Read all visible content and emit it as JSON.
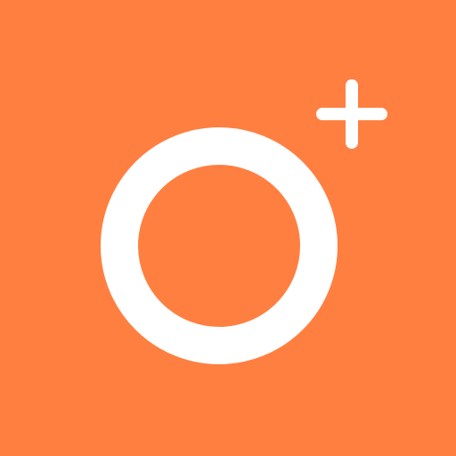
{
  "icon": {
    "name": "ring-plus-icon",
    "colors": {
      "background": "#FF7F41",
      "foreground": "#FFFFFF"
    }
  }
}
